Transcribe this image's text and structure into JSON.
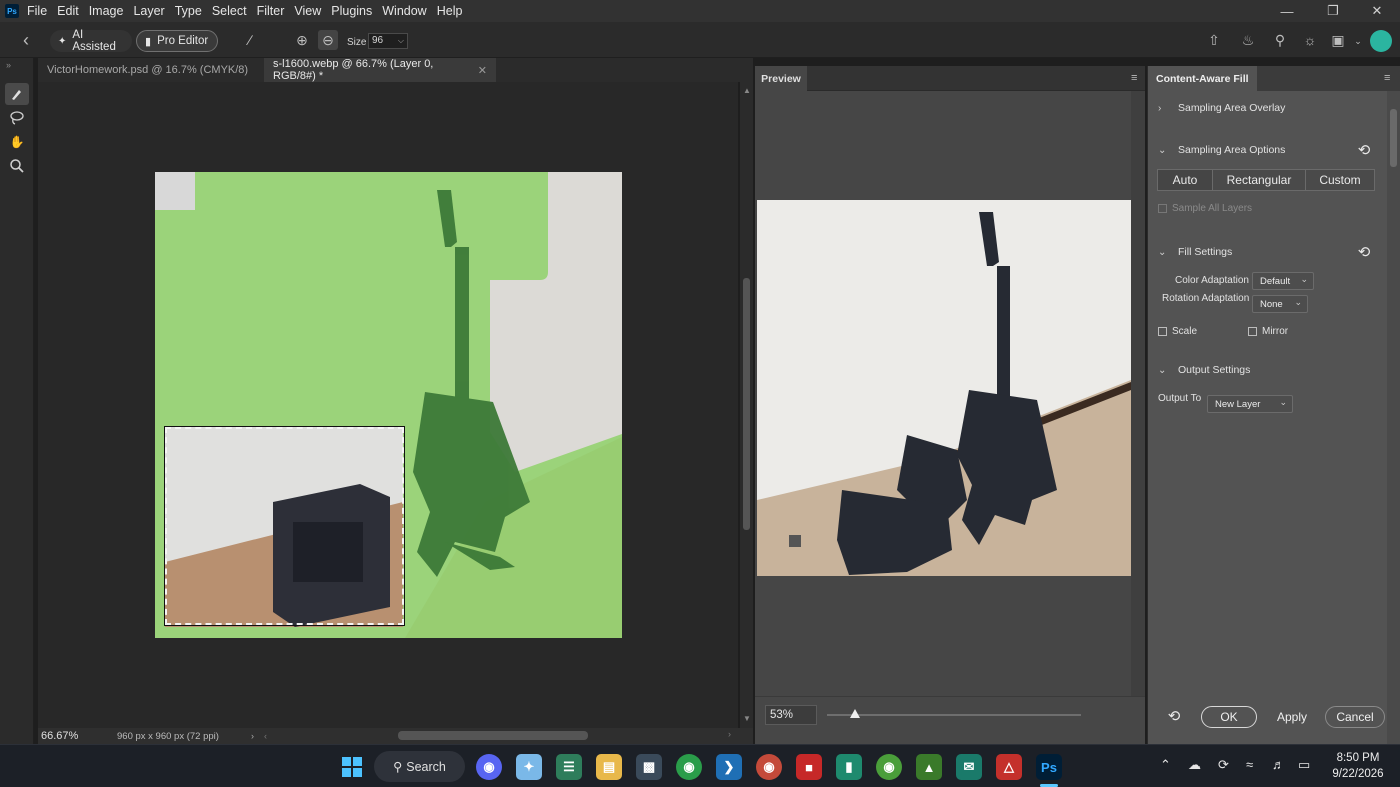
{
  "menu": {
    "logo": "Ps",
    "items": [
      "File",
      "Edit",
      "Image",
      "Layer",
      "Type",
      "Select",
      "Filter",
      "View",
      "Plugins",
      "Window",
      "Help"
    ]
  },
  "options_bar": {
    "ai_assisted_label": "AI Assisted",
    "pro_editor_label": "Pro Editor",
    "size_label": "Size",
    "size_value": "96"
  },
  "document_tabs": [
    {
      "label": "VictorHomework.psd @ 16.7% (CMYK/8)",
      "active": false
    },
    {
      "label": "s-l1600.webp @ 66.7% (Layer 0, RGB/8#) *",
      "active": true
    }
  ],
  "status_bar": {
    "zoom": "66.67%",
    "doc_info": "960 px x 960 px (72 ppi)"
  },
  "preview_panel": {
    "tab_label": "Preview",
    "zoom_value": "53%",
    "zoom_fraction": 0.53
  },
  "content_aware_fill": {
    "title": "Content-Aware Fill",
    "sampling_overlay_label": "Sampling Area Overlay",
    "sampling_options_label": "Sampling Area Options",
    "sampling_modes": [
      "Auto",
      "Rectangular",
      "Custom"
    ],
    "sampling_mode_selected": "Auto",
    "sample_all_layers_label": "Sample All Layers",
    "fill_settings_label": "Fill Settings",
    "color_adaptation_label": "Color Adaptation",
    "color_adaptation_value": "Default",
    "rotation_adaptation_label": "Rotation Adaptation",
    "rotation_adaptation_value": "None",
    "scale_label": "Scale",
    "mirror_label": "Mirror",
    "output_settings_label": "Output Settings",
    "output_to_label": "Output To",
    "output_to_value": "New Layer",
    "ok_label": "OK",
    "apply_label": "Apply",
    "cancel_label": "Cancel"
  },
  "taskbar": {
    "search_label": "Search",
    "time": "8:50 PM",
    "date": "9/22/2026"
  },
  "colors": {
    "accent_avatar": "#2bb5a0",
    "overlay_green": "#8fd16a"
  }
}
